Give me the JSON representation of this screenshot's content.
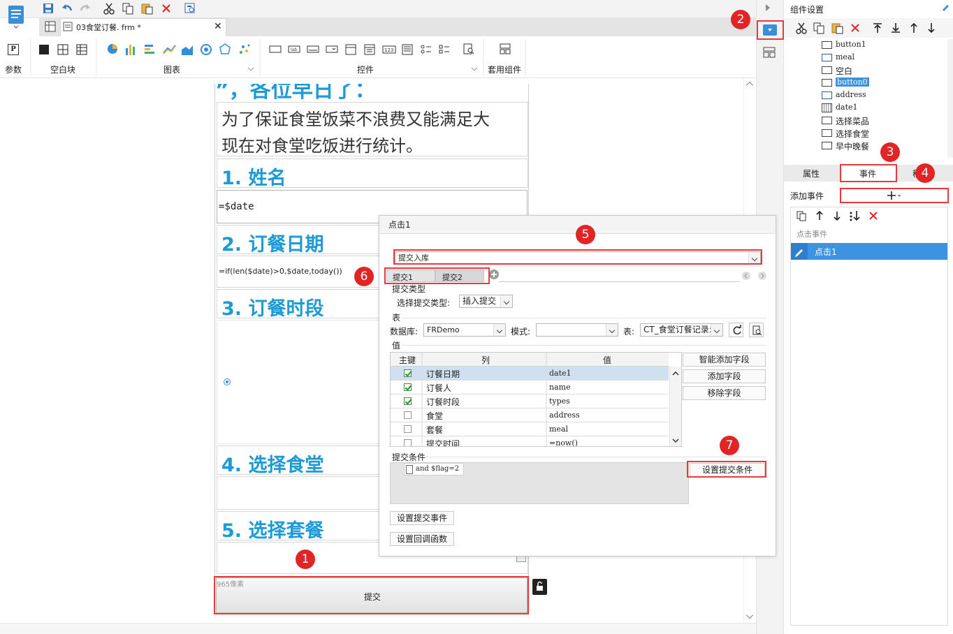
{
  "toolbar": {
    "sections": [
      "参数",
      "空白块",
      "图表",
      "控件",
      "套用组件"
    ],
    "param_icon": "P"
  },
  "tab": {
    "filename": "03食堂订餐. frm *"
  },
  "canvas": {
    "heading_partial": "”，各位早日了：",
    "intro_line1": "为了保证食堂饭菜不浪费又能满足大",
    "intro_line2": "现在对食堂吃饭进行统计。",
    "q1": "1. 姓名",
    "field_date": "=$date",
    "q2": "2. 订餐日期",
    "formula": "=if(len($date)>0,$date,today())",
    "q3": "3. 订餐时段",
    "q4": "4. 选择食堂",
    "q5": "5. 选择套餐",
    "size_hint": "965像素",
    "submit_label": "提交"
  },
  "right_panel": {
    "title": "组件设置",
    "tree": [
      "button1",
      "meal",
      "空白",
      "button0",
      "address",
      "date1",
      "选择菜品",
      "选择食堂",
      "早中晚餐"
    ],
    "tabs": [
      "属性",
      "事件",
      "移动"
    ],
    "add_event_label": "添加事件",
    "event_section": "点击事件",
    "event_item": "点击1"
  },
  "dialog": {
    "title": "点击1",
    "action_select": "提交入库",
    "sub_tabs": [
      "提交1",
      "提交2"
    ],
    "submit_type_section": "提交类型",
    "submit_type_label": "选择提交类型:",
    "submit_type_value": "插入提交",
    "table_section": "表",
    "db_label": "数据库:",
    "db_value": "FRDemo",
    "schema_label": "模式:",
    "schema_value": "",
    "table_label": "表:",
    "table_value": "CT_食堂订餐记录:",
    "value_section": "值",
    "columns": [
      "主键",
      "列",
      "值"
    ],
    "rows": [
      {
        "key": true,
        "col": "订餐日期",
        "val": "date1"
      },
      {
        "key": true,
        "col": "订餐人",
        "val": "name"
      },
      {
        "key": true,
        "col": "订餐时段",
        "val": "types"
      },
      {
        "key": false,
        "col": "食堂",
        "val": "address"
      },
      {
        "key": false,
        "col": "套餐",
        "val": "meal"
      },
      {
        "key": false,
        "col": "提交时间",
        "val": "=now()"
      }
    ],
    "side_buttons": [
      "智能添加字段",
      "添加字段",
      "移除字段"
    ],
    "condition_section": "提交条件",
    "condition_value": "and $flag=2",
    "set_condition_button": "设置提交条件",
    "set_submit_event": "设置提交事件",
    "set_callback": "设置回调函数"
  },
  "badges": [
    "1",
    "2",
    "3",
    "4",
    "5",
    "6",
    "7"
  ],
  "colors": {
    "accent": "#3b8ed8",
    "annotation": "#e12525",
    "heading": "#1e9ad6",
    "selected": "#3d93e0"
  }
}
